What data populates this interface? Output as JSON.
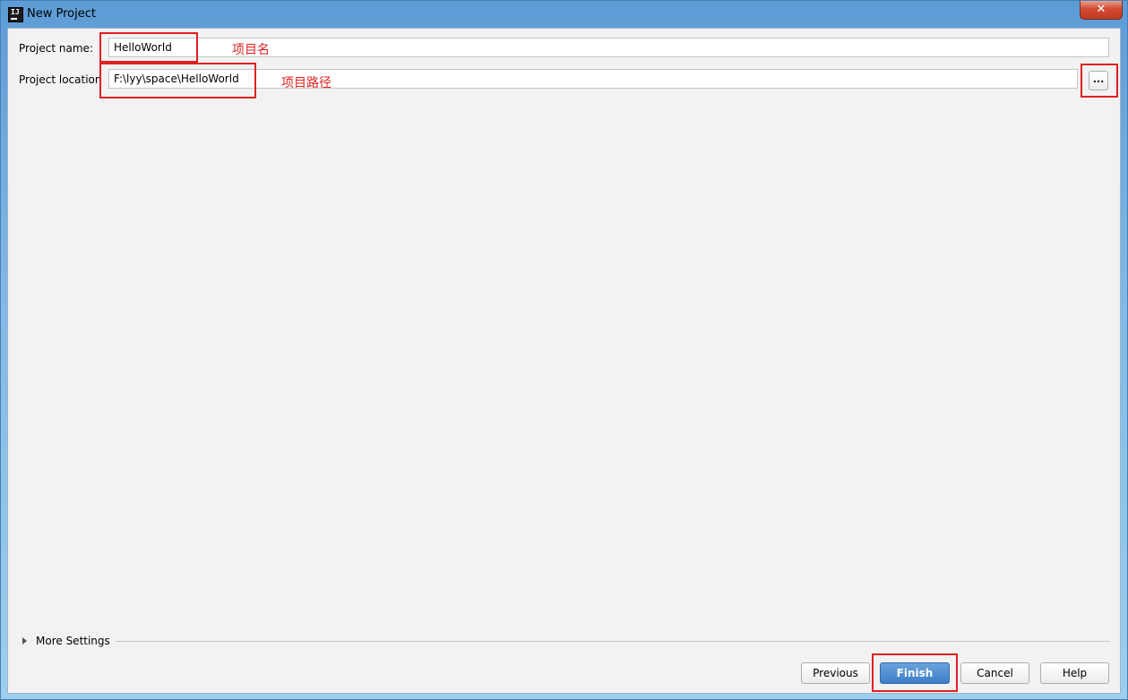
{
  "window": {
    "title": "New Project",
    "app_icon_text": "IJ",
    "close_symbol": "✕"
  },
  "form": {
    "project_name_label": "Project name:",
    "project_name_value": "HelloWorld",
    "project_location_label": "Project location:",
    "project_location_value": "F:\\lyy\\space\\HelloWorld",
    "browse_label": "..."
  },
  "annotations": {
    "name_note": "项目名",
    "location_note": "项目路径"
  },
  "more_settings": {
    "label": "More Settings"
  },
  "buttons": {
    "previous": "Previous",
    "finish": "Finish",
    "cancel": "Cancel",
    "help": "Help"
  },
  "colors": {
    "annotation": "#e02020",
    "primary_button": "#3d7fc7"
  }
}
